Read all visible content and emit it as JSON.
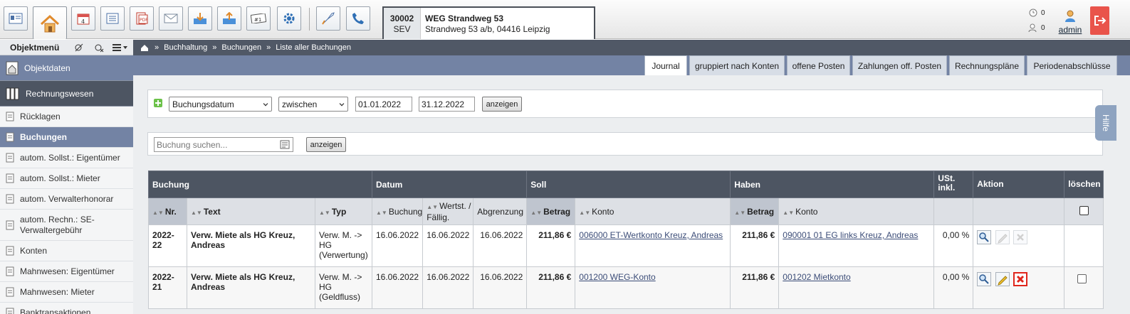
{
  "object": {
    "code": "30002",
    "type": "SEV",
    "name": "WEG Strandweg 53",
    "address": "Strandweg 53 a/b, 04416 Leipzig"
  },
  "counters": [
    "0",
    "0"
  ],
  "user": {
    "name": "admin"
  },
  "sidebar": {
    "title": "Objektmenü",
    "sections": [
      {
        "label": "Objektdaten"
      },
      {
        "label": "Rechnungswesen"
      }
    ],
    "items": [
      {
        "label": "Rücklagen"
      },
      {
        "label": "Buchungen"
      },
      {
        "label": "autom. Sollst.: Eigentümer"
      },
      {
        "label": "autom. Sollst.: Mieter"
      },
      {
        "label": "autom. Verwalterhonorar"
      },
      {
        "label": "autom. Rechn.: SE-Verwaltergebühr"
      },
      {
        "label": "Konten"
      },
      {
        "label": "Mahnwesen: Eigentümer"
      },
      {
        "label": "Mahnwesen: Mieter"
      },
      {
        "label": "Banktransaktionen"
      }
    ]
  },
  "breadcrumb": [
    "Buchhaltung",
    "Buchungen",
    "Liste aller Buchungen"
  ],
  "tabs": [
    {
      "label": "Journal"
    },
    {
      "label": "gruppiert nach Konten"
    },
    {
      "label": "offene Posten"
    },
    {
      "label": "Zahlungen off. Posten"
    },
    {
      "label": "Rechnungspläne"
    },
    {
      "label": "Periodenabschlüsse"
    }
  ],
  "filter": {
    "field": "Buchungsdatum",
    "op": "zwischen",
    "from": "01.01.2022",
    "to": "31.12.2022",
    "button": "anzeigen"
  },
  "search": {
    "placeholder": "Buchung suchen...",
    "button": "anzeigen"
  },
  "help": "Hilfe",
  "table": {
    "groups": [
      "Buchung",
      "Datum",
      "Soll",
      "Haben",
      "USt. inkl.",
      "Aktion",
      "löschen"
    ],
    "cols": [
      "Nr.",
      "Text",
      "Typ",
      "Buchung",
      "Wertst. / Fällig.",
      "Abgrenzung",
      "Betrag",
      "Konto",
      "Betrag",
      "Konto"
    ],
    "rows": [
      {
        "nr": "2022-22",
        "text": "Verw. Miete als HG Kreuz, Andreas",
        "typ": "Verw. M. -> HG (Verwertung)",
        "buchung": "16.06.2022",
        "wertst": "16.06.2022",
        "abgr": "16.06.2022",
        "soll_betrag": "211,86 €",
        "soll_konto": "006000 ET-Wertkonto Kreuz, Andreas",
        "haben_betrag": "211,86 €",
        "haben_konto": "090001 01 EG links Kreuz, Andreas",
        "ust": "0,00 %"
      },
      {
        "nr": "2022-21",
        "text": "Verw. Miete als HG Kreuz, Andreas",
        "typ": "Verw. M. -> HG (Geldfluss)",
        "buchung": "16.06.2022",
        "wertst": "16.06.2022",
        "abgr": "16.06.2022",
        "soll_betrag": "211,86 €",
        "soll_konto": "001200 WEG-Konto",
        "haben_betrag": "211,86 €",
        "haben_konto": "001202 Mietkonto",
        "ust": "0,00 %"
      }
    ]
  }
}
